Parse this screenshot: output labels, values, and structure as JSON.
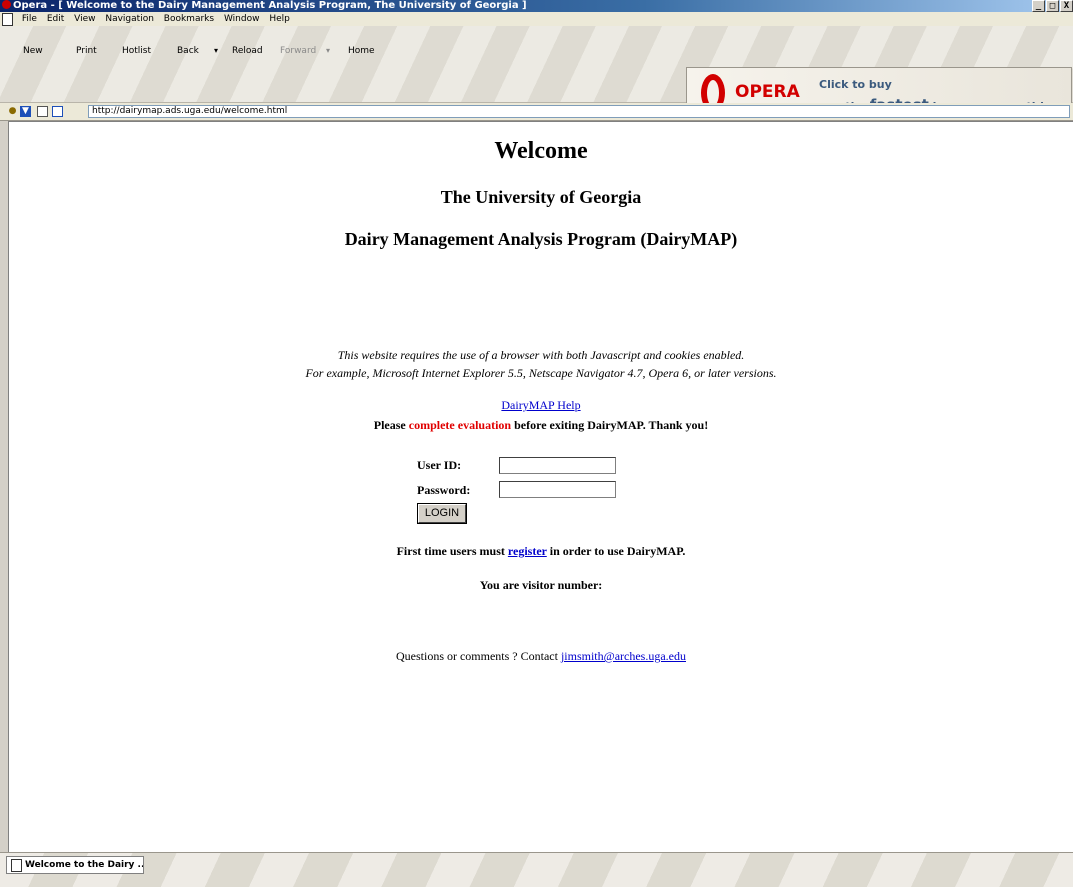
{
  "window": {
    "title": "Opera - [ Welcome to the Dairy Management Analysis Program, The University of Georgia ]",
    "controls": [
      "_",
      "□",
      "X"
    ]
  },
  "menu": [
    "File",
    "Edit",
    "View",
    "Navigation",
    "Bookmarks",
    "Window",
    "Help"
  ],
  "toolbar": {
    "new": "New",
    "print": "Print",
    "hotlist": "Hotlist",
    "back": "Back",
    "reload": "Reload",
    "forward": "Forward",
    "home": "Home",
    "arrow": "▾"
  },
  "ad": {
    "brand": "OPERA",
    "line1": "Click to buy",
    "line2_prefix": "- the ",
    "line2_bold": "fastest",
    "line2_suffix": " browser on earth!"
  },
  "address": {
    "url": "http://dairymap.ads.uga.edu/welcome.html"
  },
  "page": {
    "welcome": "Welcome",
    "university": "The University of Georgia",
    "program": "Dairy Management Analysis Program (DairyMAP)",
    "req1": "This website requires the use of a browser with both Javascript and cookies enabled.",
    "req2": "For example, Microsoft Internet Explorer 5.5, Netscape Navigator 4.7, Opera 6, or later versions.",
    "help_link": "DairyMAP Help",
    "eval_pre": "Please ",
    "eval_link": "complete evaluation",
    "eval_post": " before exiting DairyMAP. Thank you!",
    "userid_label": "User ID:",
    "password_label": "Password:",
    "userid_value": "",
    "password_value": "",
    "login": "LOGIN",
    "first_pre": "First time users must ",
    "register": "register",
    "first_post": " in order to use DairyMAP.",
    "visitor": "You are visitor number:",
    "contact_pre": "Questions or comments ? Contact ",
    "contact_email": "jimsmith@arches.uga.edu"
  },
  "taskbar": {
    "item": "Welcome to the Dairy ..."
  }
}
